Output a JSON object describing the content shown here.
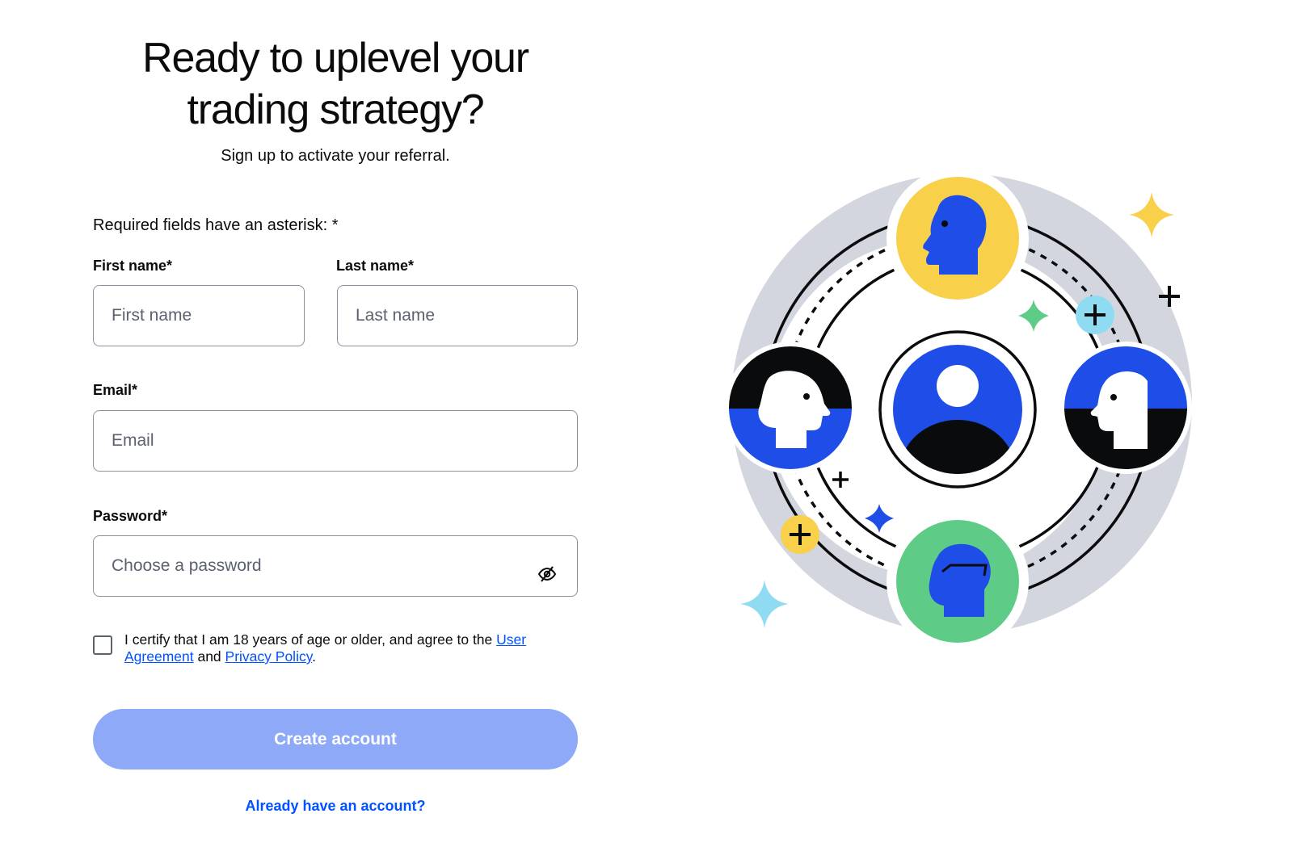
{
  "heading": {
    "line1": "Ready to uplevel your",
    "line2": "trading strategy?"
  },
  "subheading": "Sign up to activate your referral.",
  "required_note": "Required fields have an asterisk: *",
  "fields": {
    "first_name": {
      "label": "First name*",
      "placeholder": "First name",
      "value": ""
    },
    "last_name": {
      "label": "Last name*",
      "placeholder": "Last name",
      "value": ""
    },
    "email": {
      "label": "Email*",
      "placeholder": "Email",
      "value": ""
    },
    "password": {
      "label": "Password*",
      "placeholder": "Choose a password",
      "value": "",
      "toggle_icon": "eye-slash-icon"
    }
  },
  "terms": {
    "checked": false,
    "text_before": "I certify that I am 18 years of age or older, and agree to the ",
    "user_agreement_link": "User Agreement",
    "text_middle": " and ",
    "privacy_policy_link": "Privacy Policy",
    "text_after": "."
  },
  "create_button_label": "Create account",
  "signin_link_label": "Already have an account?",
  "colors": {
    "brand_blue": "#0052ff",
    "button_disabled": "#8da9f8",
    "illustration_blue": "#1f4de8",
    "illustration_yellow": "#f8d04a",
    "illustration_green": "#5ecb86",
    "illustration_cyan": "#8fdcf2",
    "illustration_gray": "#d3d6de"
  },
  "illustration": {
    "icons": [
      "person-avatar-icon",
      "head-profile-icon",
      "plus-icon",
      "sparkle-icon"
    ]
  }
}
